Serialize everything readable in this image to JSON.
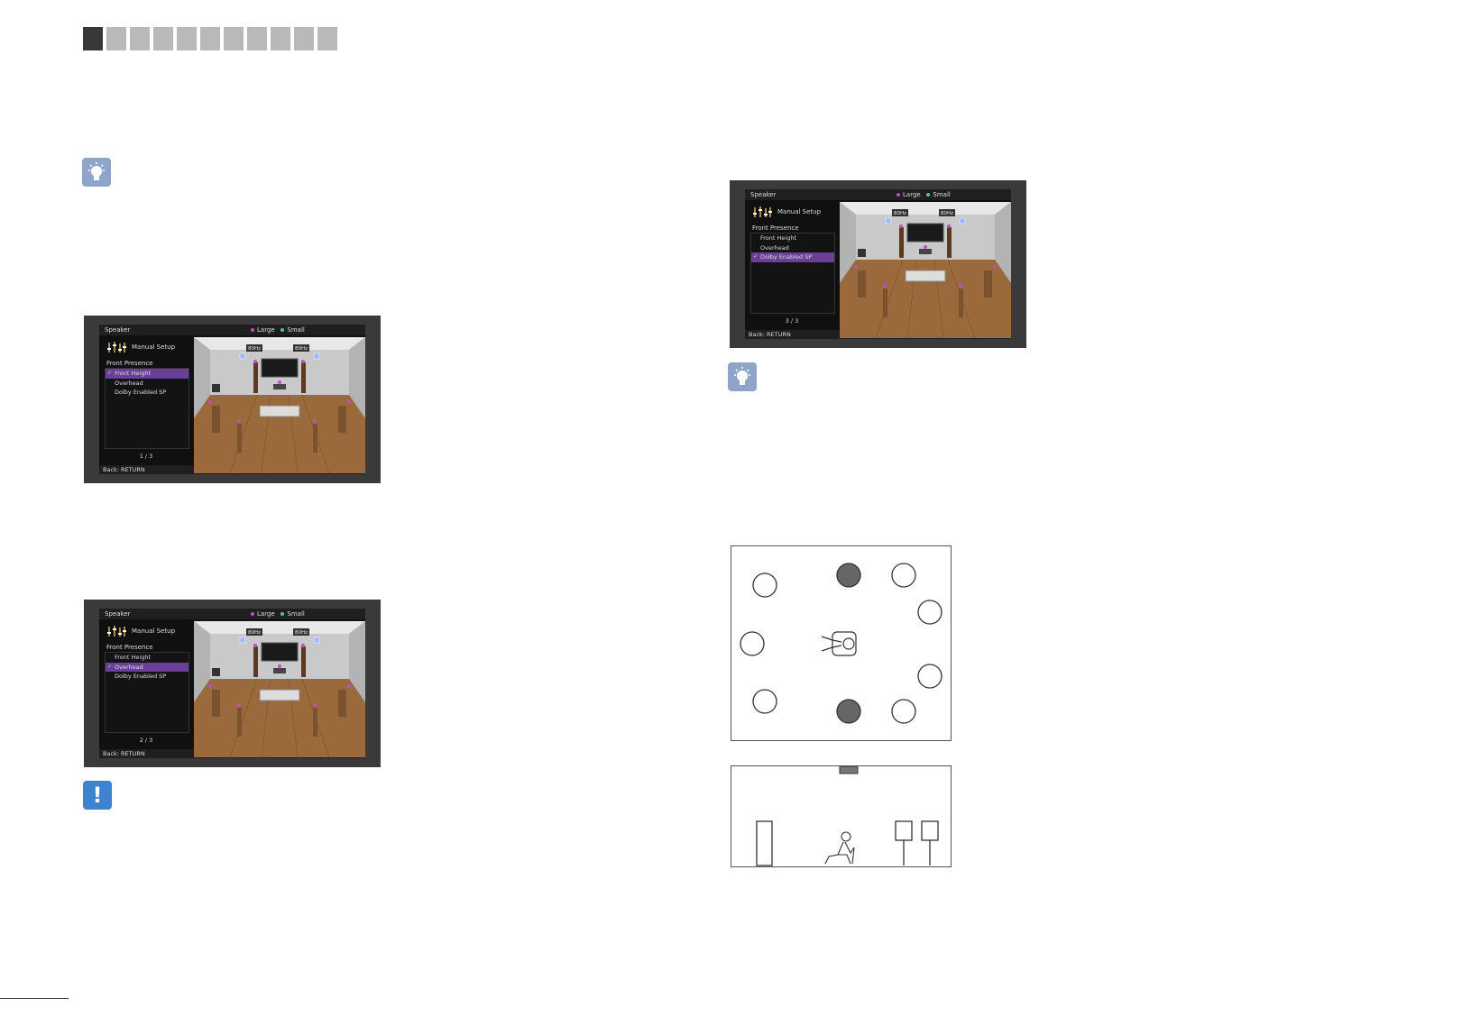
{
  "section_tabs": {
    "count": 11,
    "active_index": 0
  },
  "screens": [
    {
      "header_title": "Speaker",
      "legend_large": "Large",
      "legend_small": "Small",
      "menu_title": "Manual Setup",
      "parameter": "Front Presence",
      "items": [
        "Front Height",
        "Overhead",
        "Dolby Enabled SP"
      ],
      "selected_index": 0,
      "page": "1 / 3",
      "footer": "Back: RETURN",
      "freq_left": "80Hz",
      "freq_right": "80Hz"
    },
    {
      "header_title": "Speaker",
      "legend_large": "Large",
      "legend_small": "Small",
      "menu_title": "Manual Setup",
      "parameter": "Front Presence",
      "items": [
        "Front Height",
        "Overhead",
        "Dolby Enabled SP"
      ],
      "selected_index": 1,
      "page": "2 / 3",
      "footer": "Back: RETURN",
      "freq_left": "80Hz",
      "freq_right": "80Hz"
    },
    {
      "header_title": "Speaker",
      "legend_large": "Large",
      "legend_small": "Small",
      "menu_title": "Manual Setup",
      "parameter": "Front Presence",
      "items": [
        "Front Height",
        "Overhead",
        "Dolby Enabled SP"
      ],
      "selected_index": 2,
      "page": "3 / 3",
      "footer": "Back: RETURN",
      "freq_left": "80Hz",
      "freq_right": "80Hz"
    }
  ],
  "icons": {
    "tip": "lightbulb-icon",
    "warning": "exclamation-icon"
  },
  "warning_glyph": "!",
  "colors": {
    "large_dot": "#c04fc0",
    "small_dot": "#4fc0c0",
    "selection": "#6a3f9a",
    "tab_active": "#383838",
    "tab_inactive": "#b9b9b9"
  }
}
